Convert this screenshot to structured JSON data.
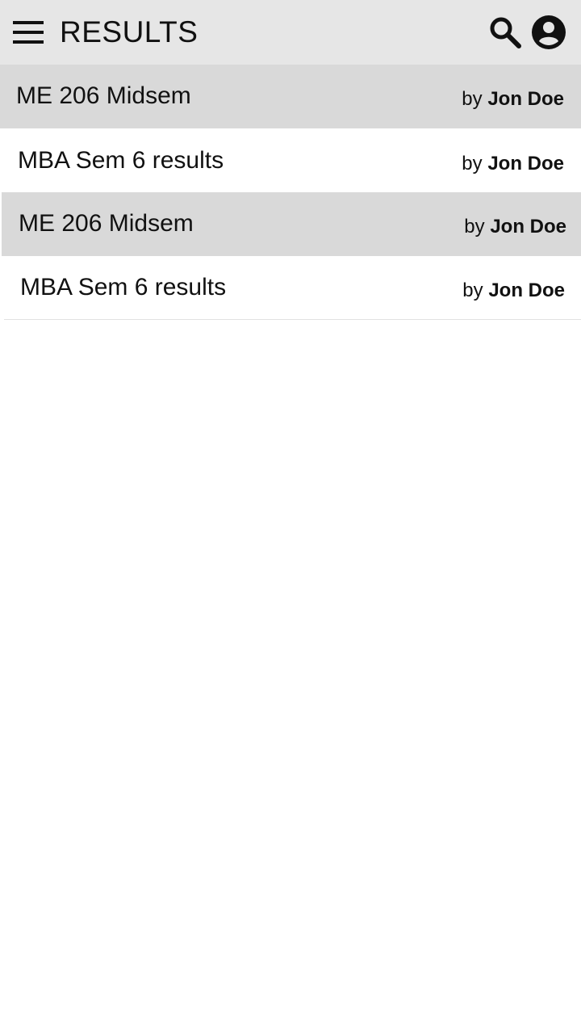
{
  "header": {
    "menu_icon": "menu-icon",
    "title": "RESULTS",
    "search_icon": "search-icon",
    "account_icon": "account-circle-icon"
  },
  "results": [
    {
      "title": "ME 206 Midsem",
      "by_label": "by",
      "author": "Jon Doe"
    },
    {
      "title": "MBA Sem 6 results",
      "by_label": "by",
      "author": "Jon Doe"
    },
    {
      "title": "ME 206 Midsem",
      "by_label": "by",
      "author": "Jon Doe"
    },
    {
      "title": "MBA Sem 6 results",
      "by_label": "by",
      "author": "Jon Doe"
    }
  ],
  "colors": {
    "header_background": "#e6e6e6",
    "shaded_row": "#d9d9d9",
    "page_background": "#ffffff",
    "text": "#111111"
  }
}
